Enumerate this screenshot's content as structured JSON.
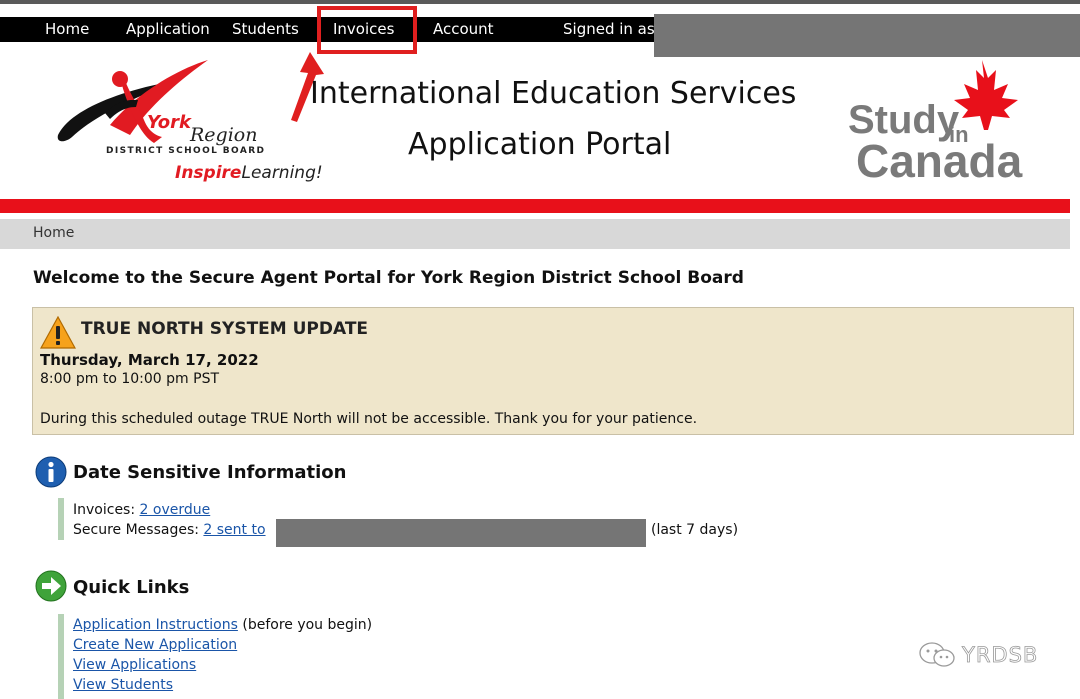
{
  "nav": {
    "items": [
      {
        "label": "Home"
      },
      {
        "label": "Application"
      },
      {
        "label": "Students"
      },
      {
        "label": "Invoices"
      },
      {
        "label": "Account"
      }
    ],
    "signed_in_text": "Signed in as"
  },
  "header": {
    "logo": {
      "york": "York",
      "region": "Region",
      "district": "DISTRICT SCHOOL BOARD",
      "inspire": "Inspire",
      "learning": "Learning!"
    },
    "title_line1": "International Education Services",
    "title_line2": "Application Portal",
    "study_logo": {
      "study": "Study",
      "in": "in",
      "canada": "Canada"
    }
  },
  "breadcrumb": {
    "home": "Home"
  },
  "welcome": "Welcome to the Secure Agent Portal for York Region District School Board",
  "notice": {
    "title": "TRUE NORTH SYSTEM UPDATE",
    "date": "Thursday, March 17, 2022",
    "time": "8:00 pm to 10:00 pm PST",
    "body": "During this scheduled outage TRUE North will not be accessible. Thank you for your patience."
  },
  "date_sensitive": {
    "heading": "Date Sensitive Information",
    "invoices_label": "Invoices: ",
    "invoices_link": "2 overdue",
    "messages_label": "Secure Messages: ",
    "messages_link": "2 sent to",
    "messages_suffix": "(last 7 days)"
  },
  "quick_links": {
    "heading": "Quick Links",
    "items": [
      {
        "label": "Application Instructions",
        "suffix": " (before you begin)"
      },
      {
        "label": "Create New Application",
        "suffix": ""
      },
      {
        "label": "View Applications",
        "suffix": ""
      },
      {
        "label": "View Students",
        "suffix": ""
      }
    ]
  },
  "watermark": "YRDSB",
  "colors": {
    "nav_bg": "#000000",
    "brand_red": "#e8101a",
    "link": "#1a55a8",
    "notice_bg": "#efe6cb",
    "redaction": "#757575"
  }
}
